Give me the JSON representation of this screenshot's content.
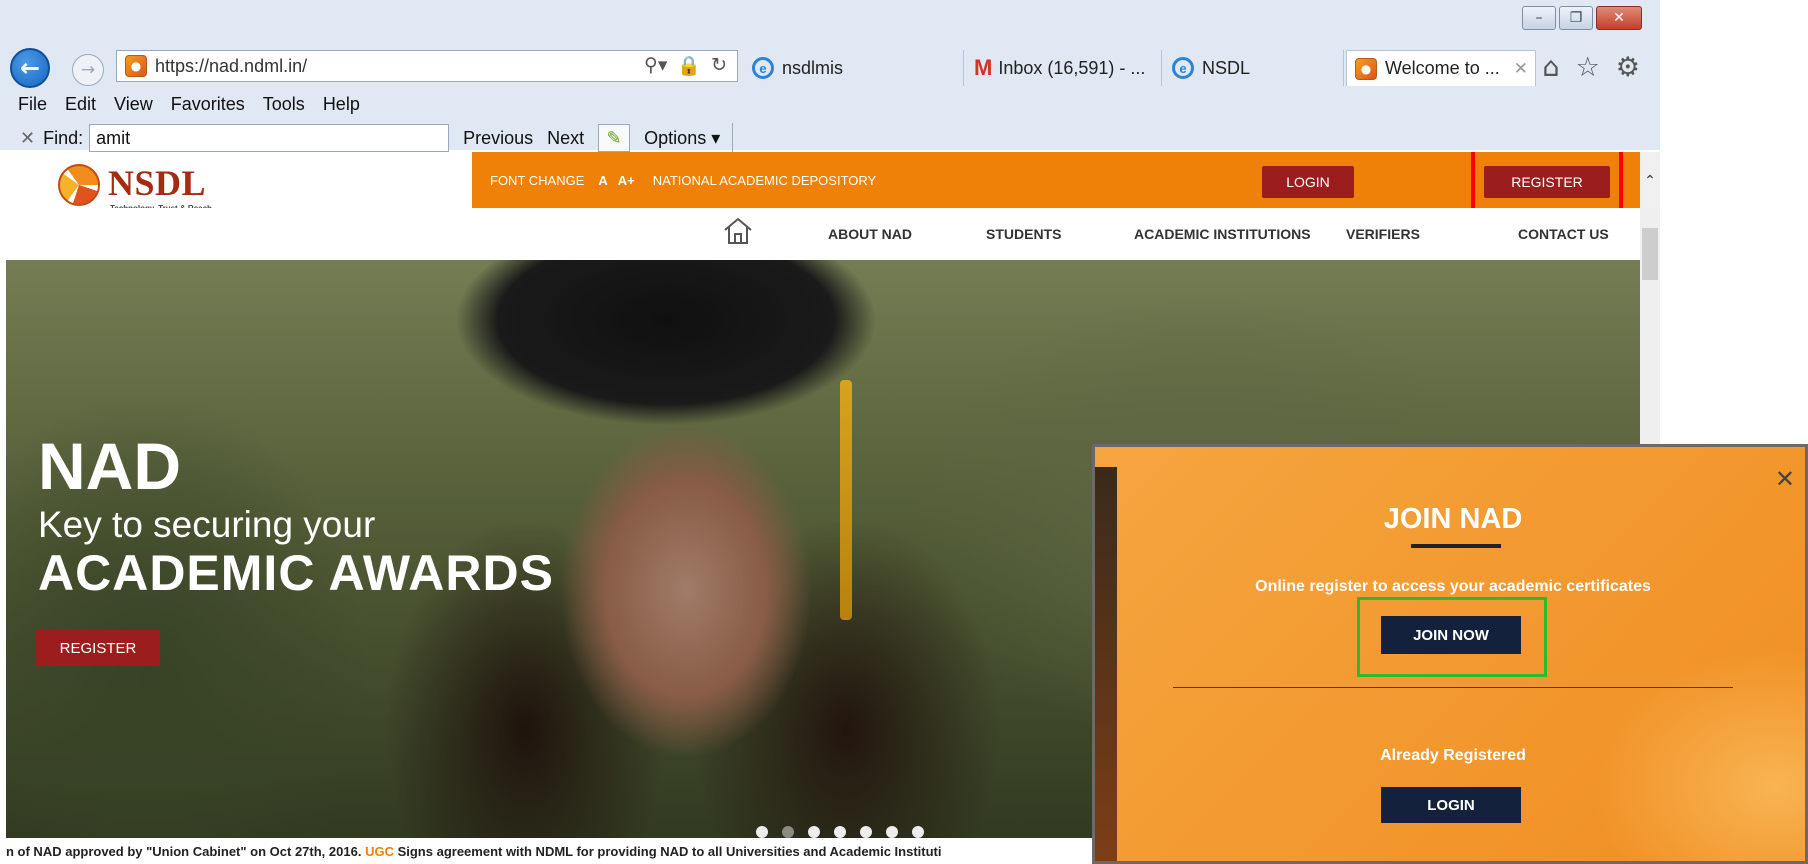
{
  "browser": {
    "address": "https://nad.ndml.in/",
    "tabs": [
      {
        "label": "nsdlmis",
        "icon": "ie-icon"
      },
      {
        "label": "Inbox (16,591) - ...",
        "icon": "gmail-icon"
      },
      {
        "label": "NSDL",
        "icon": "ie-icon"
      },
      {
        "label": "Welcome to ...",
        "icon": "nsdl-favicon",
        "active": true
      }
    ],
    "menu": [
      "File",
      "Edit",
      "View",
      "Favorites",
      "Tools",
      "Help"
    ],
    "find": {
      "label": "Find:",
      "value": "amit",
      "previous": "Previous",
      "next": "Next",
      "options": "Options"
    }
  },
  "site": {
    "logo_text": "NSDL",
    "logo_tagline": "Technology, Trust & Reach",
    "topbar": {
      "font_change": "FONT CHANGE",
      "font_a": "A",
      "font_a_plus": "A+",
      "depository": "NATIONAL ACADEMIC DEPOSITORY",
      "login": "LOGIN",
      "register": "REGISTER"
    },
    "nav": [
      "ABOUT NAD",
      "STUDENTS",
      "ACADEMIC INSTITUTIONS",
      "VERIFIERS",
      "CONTACT US"
    ],
    "hero": {
      "title": "NAD",
      "subtitle": "Key to securing your",
      "headline": "ACADEMIC AWARDS",
      "button": "REGISTER"
    },
    "ticker": {
      "prefix": "n of NAD approved by \"Union Cabinet\" on Oct 27th, 2016.",
      "ugc": "UGC",
      "rest": "Signs agreement with NDML for providing NAD to all Universities and Academic Instituti"
    }
  },
  "modal": {
    "title": "JOIN NAD",
    "description": "Online register to access your academic certificates",
    "join_button": "JOIN NOW",
    "already": "Already Registered",
    "login_button": "LOGIN"
  },
  "colors": {
    "orange": "#f08108",
    "maroon": "#9b1d1d",
    "navy": "#14213d",
    "highlight_red": "#ff0000",
    "highlight_green": "#2dbb2d"
  }
}
